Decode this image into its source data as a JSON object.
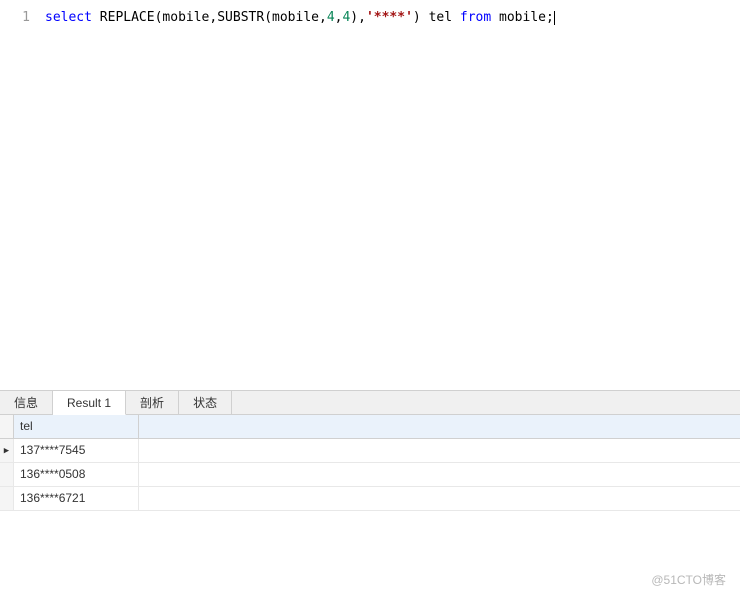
{
  "editor": {
    "line_number": "1",
    "code": {
      "t1": "select",
      "t2": " REPLACE",
      "t3": "(",
      "t4": "mobile",
      "t5": ",",
      "t6": "SUBSTR",
      "t7": "(",
      "t8": "mobile",
      "t9": ",",
      "t10": "4",
      "t11": ",",
      "t12": "4",
      "t13": ")",
      "t14": ",",
      "t15": "'****'",
      "t16": ")",
      "t17": " tel ",
      "t18": "from",
      "t19": " mobile;"
    }
  },
  "tabs": {
    "info": "信息",
    "result": "Result 1",
    "profile": "剖析",
    "status": "状态"
  },
  "result": {
    "column": "tel",
    "rows": [
      "137****7545",
      "136****0508",
      "136****6721"
    ]
  },
  "watermark": "@51CTO博客",
  "chart_data": {
    "type": "table",
    "title": "SQL Result",
    "columns": [
      "tel"
    ],
    "rows": [
      [
        "137****7545"
      ],
      [
        "136****0508"
      ],
      [
        "136****6721"
      ]
    ]
  }
}
